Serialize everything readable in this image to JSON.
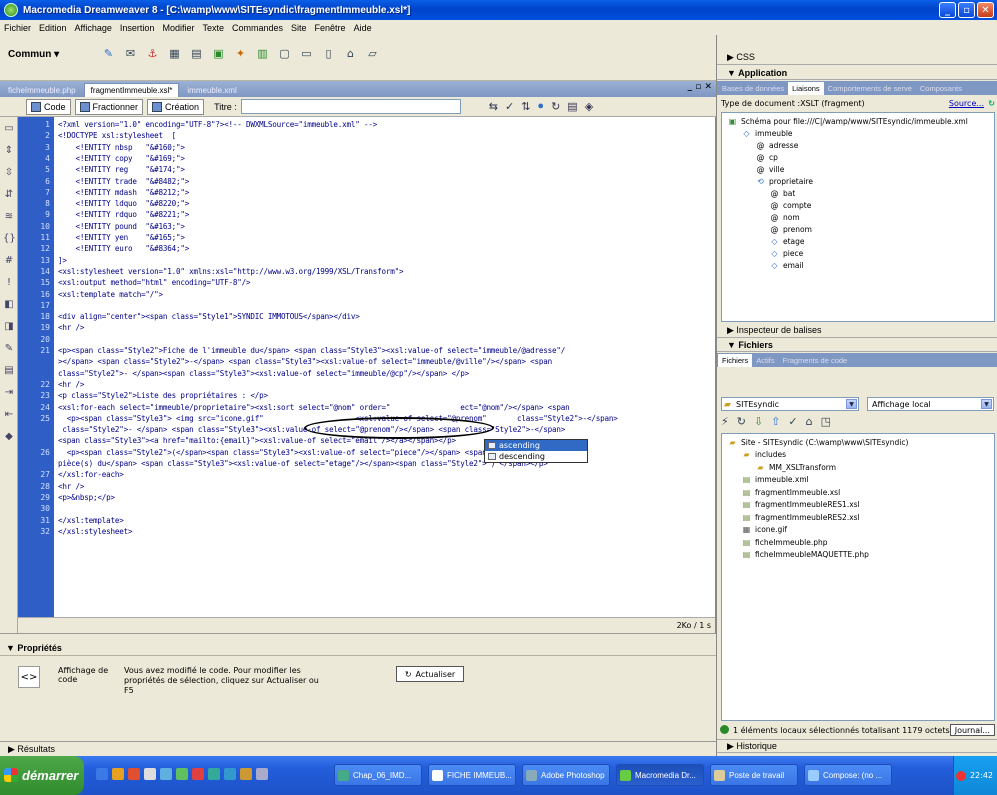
{
  "window": {
    "title": "Macromedia Dreamweaver 8 - [C:\\wamp\\www\\SITEsyndic\\fragmentImmeuble.xsl*]"
  },
  "menu": [
    "Fichier",
    "Edition",
    "Affichage",
    "Insertion",
    "Modifier",
    "Texte",
    "Commandes",
    "Site",
    "Fenêtre",
    "Aide"
  ],
  "insert_toolbar": {
    "category": "Commun ▾"
  },
  "doc_tabs": [
    {
      "label": "ficheImmeuble.php",
      "active": false
    },
    {
      "label": "fragmentImmeuble.xsl*",
      "active": true
    },
    {
      "label": "immeuble.xml",
      "active": false
    }
  ],
  "doc_toolbar": {
    "code": "Code",
    "split": "Fractionner",
    "design": "Création",
    "title_label": "Titre :",
    "title_value": ""
  },
  "code_lines": [
    {
      "n": "1",
      "text": "<?xml version=\"1.0\" encoding=\"UTF-8\"?><!-- DWXMLSource=\"immeuble.xml\" -->"
    },
    {
      "n": "2",
      "text": "<!DOCTYPE xsl:stylesheet  ["
    },
    {
      "n": "3",
      "text": "\t<!ENTITY nbsp   \"&#160;\">"
    },
    {
      "n": "4",
      "text": "\t<!ENTITY copy   \"&#169;\">"
    },
    {
      "n": "5",
      "text": "\t<!ENTITY reg    \"&#174;\">"
    },
    {
      "n": "6",
      "text": "\t<!ENTITY trade  \"&#8482;\">"
    },
    {
      "n": "7",
      "text": "\t<!ENTITY mdash  \"&#8212;\">"
    },
    {
      "n": "8",
      "text": "\t<!ENTITY ldquo  \"&#8220;\">"
    },
    {
      "n": "9",
      "text": "\t<!ENTITY rdquo  \"&#8221;\">"
    },
    {
      "n": "10",
      "text": "\t<!ENTITY pound  \"&#163;\">"
    },
    {
      "n": "11",
      "text": "\t<!ENTITY yen    \"&#165;\">"
    },
    {
      "n": "12",
      "text": "\t<!ENTITY euro   \"&#8364;\">"
    },
    {
      "n": "13",
      "text": "]>"
    },
    {
      "n": "14",
      "text": "<xsl:stylesheet version=\"1.0\" xmlns:xsl=\"http://www.w3.org/1999/XSL/Transform\">"
    },
    {
      "n": "15",
      "text": "<xsl:output method=\"html\" encoding=\"UTF-8\"/>"
    },
    {
      "n": "16",
      "text": "<xsl:template match=\"/\">"
    },
    {
      "n": "17",
      "text": ""
    },
    {
      "n": "18",
      "text": "<div align=\"center\"><span class=\"Style1\">SYNDIC IMMOTOUS</span></div>"
    },
    {
      "n": "19",
      "text": "<hr />"
    },
    {
      "n": "20",
      "text": ""
    },
    {
      "n": "21",
      "text": "<p><span class=\"Style2\">Fiche de l'immeuble du</span> <span class=\"Style3\"><xsl:value-of select=\"immeuble/@adresse\"/"
    },
    {
      "n": "",
      "text": "></span> <span class=\"Style2\">-</span> <span class=\"Style3\"><xsl:value-of select=\"immeuble/@ville\"/></span> <span"
    },
    {
      "n": "",
      "text": "class=\"Style2\">- </span><span class=\"Style3\"><xsl:value-of select=\"immeuble/@cp\"/></span> </p>"
    },
    {
      "n": "22",
      "text": "<hr />"
    },
    {
      "n": "23",
      "text": "<p class=\"Style2\">Liste des propriétaires : </p>"
    },
    {
      "n": "24",
      "text": "<xsl:for-each select=\"immeuble/proprietaire\"><xsl:sort select=\"@nom\" order=\"                ect=\"@nom\"/></span> <span"
    },
    {
      "n": "25",
      "text": "  <p><span class=\"Style3\"> <img src=\"icone.gif\"                     <xsl:value-of select=\"@prenom\"       class=\"Style2\">-</span>"
    },
    {
      "n": "",
      "text": " class=\"Style2\">- </span> <span class=\"Style3\"><xsl:value-of select=\"@prenom\"/></span> <span class=\"Style2\">-</span>"
    },
    {
      "n": "",
      "text": "<span class=\"Style3\"><a href=\"mailto:{email}\"><xsl:value-of select=\"email\"/></a></span></p>"
    },
    {
      "n": "26",
      "text": "  <p><span class=\"Style2\">(</span><span class=\"Style3\"><xsl:value-of select=\"piece\"/></span> <span class=\"Style2\">"
    },
    {
      "n": "",
      "text": "pièce(s) du</span> <span class=\"Style3\"><xsl:value-of select=\"etage\"/></span><span class=\"Style2\"> ) </span></p>"
    },
    {
      "n": "27",
      "text": "</xsl:for-each>"
    },
    {
      "n": "28",
      "text": "<hr />"
    },
    {
      "n": "29",
      "text": "<p>&nbsp;</p>"
    },
    {
      "n": "30",
      "text": ""
    },
    {
      "n": "31",
      "text": "</xsl:template>"
    },
    {
      "n": "32",
      "text": "</xsl:stylesheet>"
    }
  ],
  "autocomplete": {
    "options": [
      "ascending",
      "descending"
    ],
    "selected": "ascending"
  },
  "status": {
    "size": "2Ko / 1 s"
  },
  "properties": {
    "header": "▼ Propriétés",
    "label": "Affichage de code",
    "message": "Vous avez modifié le code. Pour modifier les propriétés de sélection, cliquez sur Actualiser ou F5",
    "refresh_button": "Actualiser"
  },
  "results": "▶ Résultats",
  "right": {
    "css": "▶ CSS",
    "application": "▼ Application",
    "app_tabs": [
      "Bases de données",
      "Liaisons",
      "Comportements de serve",
      "Composants"
    ],
    "active_app_tab": "Liaisons",
    "doctype_label": "Type de document :XSLT (fragment)",
    "source_link": "Source...",
    "schema_tree": [
      {
        "label": "Schéma pour file:///C|/wamp/www/SITEsyndic/immeuble.xml",
        "depth": 0,
        "icon": "schema"
      },
      {
        "label": "immeuble",
        "depth": 1,
        "icon": "element"
      },
      {
        "label": "adresse",
        "depth": 2,
        "icon": "attribute"
      },
      {
        "label": "cp",
        "depth": 2,
        "icon": "attribute"
      },
      {
        "label": "ville",
        "depth": 2,
        "icon": "attribute"
      },
      {
        "label": "proprietaire",
        "depth": 2,
        "icon": "repeat"
      },
      {
        "label": "bat",
        "depth": 3,
        "icon": "attribute"
      },
      {
        "label": "compte",
        "depth": 3,
        "icon": "attribute"
      },
      {
        "label": "nom",
        "depth": 3,
        "icon": "attribute"
      },
      {
        "label": "prenom",
        "depth": 3,
        "icon": "attribute"
      },
      {
        "label": "etage",
        "depth": 3,
        "icon": "element"
      },
      {
        "label": "piece",
        "depth": 3,
        "icon": "element"
      },
      {
        "label": "email",
        "depth": 3,
        "icon": "element"
      }
    ],
    "tag_inspector": "▶ Inspecteur de balises",
    "files_header": "▼ Fichiers",
    "file_tabs": [
      "Fichiers",
      "Actifs",
      "Fragments de code"
    ],
    "active_file_tab": "Fichiers",
    "site_select": "SITEsyndic",
    "view_select": "Affichage local",
    "files_tree": [
      {
        "label": "Site - SITEsyndic (C:\\wamp\\www\\SITEsyndic)",
        "depth": 0,
        "icon": "folder"
      },
      {
        "label": "includes",
        "depth": 1,
        "icon": "folder"
      },
      {
        "label": "MM_XSLTransform",
        "depth": 2,
        "icon": "folder"
      },
      {
        "label": "immeuble.xml",
        "depth": 1,
        "icon": "file"
      },
      {
        "label": "fragmentImmeuble.xsl",
        "depth": 1,
        "icon": "file"
      },
      {
        "label": "fragmentImmeubleRES1.xsl",
        "depth": 1,
        "icon": "file"
      },
      {
        "label": "fragmentImmeubleRES2.xsl",
        "depth": 1,
        "icon": "file"
      },
      {
        "label": "icone.gif",
        "depth": 1,
        "icon": "image"
      },
      {
        "label": "ficheImmeuble.php",
        "depth": 1,
        "icon": "file"
      },
      {
        "label": "ficheImmeubleMAQUETTE.php",
        "depth": 1,
        "icon": "file"
      }
    ],
    "status_text": "1 éléments locaux sélectionnés totalisant 1179 octets",
    "journal_button": "Journal...",
    "history": "▶ Historique"
  },
  "taskbar": {
    "start": "démarrer",
    "items": [
      {
        "label": "Chap_06_IMD...",
        "active": false
      },
      {
        "label": "FICHE IMMEUB...",
        "active": false
      },
      {
        "label": "Adobe Photoshop",
        "active": false
      },
      {
        "label": "Macromedia Dr...",
        "active": true
      },
      {
        "label": "Poste de travail",
        "active": false
      },
      {
        "label": "Compose: (no ...",
        "active": false
      }
    ],
    "clock": "22:42"
  },
  "colors": {
    "title_blue": "#0a5ee8",
    "line_number_bg": "#2f5fc6",
    "code_text": "#000088",
    "taskbar": "#245edb",
    "start_green": "#3c9a38"
  }
}
